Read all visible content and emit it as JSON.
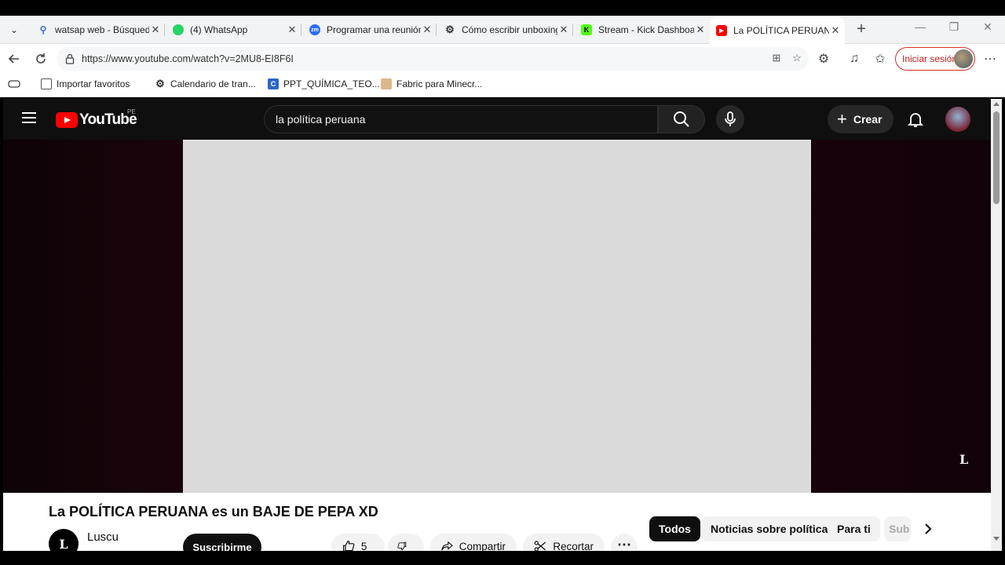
{
  "browser": {
    "tabs": [
      {
        "title": "watsap web - Búsqueda",
        "icon": "search-icon"
      },
      {
        "title": "(4) WhatsApp",
        "icon": "whatsapp-icon"
      },
      {
        "title": "Programar una reunión",
        "icon": "zoom-icon"
      },
      {
        "title": "Cómo escribir unboxing",
        "icon": "openai-icon"
      },
      {
        "title": "Stream - Kick Dashboard",
        "icon": "kick-icon"
      },
      {
        "title": "La POLÍTICA PERUANA es",
        "icon": "youtube-icon"
      }
    ],
    "address_url": "https://www.youtube.com/watch?v=2MU8-EI8F6I",
    "sign_in_label": "Iniciar sesión",
    "bookmarks": [
      {
        "label": "Importar favoritos",
        "icon": "import-icon"
      },
      {
        "label": "Calendario de tran...",
        "icon": "openai-icon"
      },
      {
        "label": "PPT_QUÍMICA_TEO...",
        "icon": "doc-icon"
      },
      {
        "label": "Fabric para Minecr...",
        "icon": "fabric-icon"
      }
    ]
  },
  "youtube": {
    "logo_text": "YouTube",
    "country_code": "PE",
    "search_query": "la política peruana",
    "create_label": "Crear",
    "video_title": "La POLÍTICA PERUANA es un BAJE DE PEPA XD",
    "watermark": "L",
    "channel_initial": "L",
    "channel_name": "Luscu",
    "subscribe_label": "Suscribirme",
    "likes": "5 K",
    "share_label": "Compartir",
    "clip_label": "Recortar",
    "chips": [
      "Todos",
      "Noticias sobre política",
      "Para ti",
      "Sub"
    ]
  },
  "colors": {
    "youtube_red": "#ff0000",
    "signin_red": "#d93025",
    "chip_active": "#0f0f0f"
  }
}
